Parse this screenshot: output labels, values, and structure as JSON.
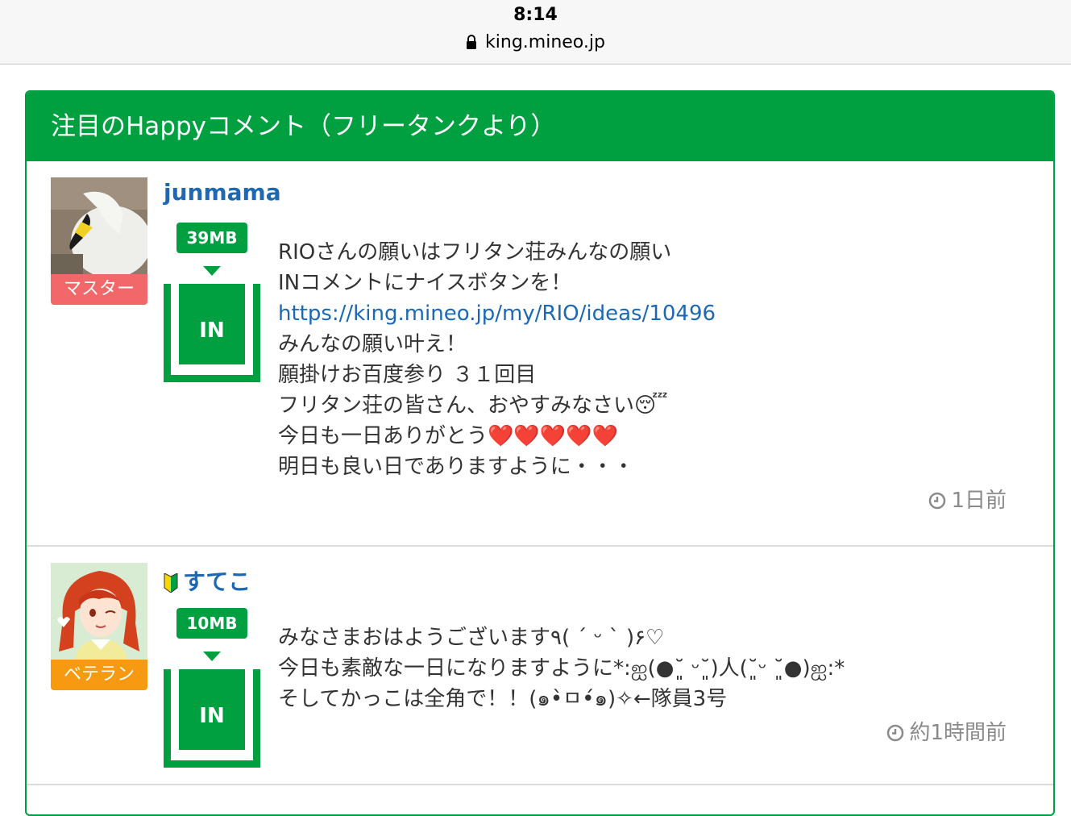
{
  "status_bar": {
    "time": "8:14",
    "url": "king.mineo.jp"
  },
  "panel": {
    "title": "注目のHappyコメント（フリータンクより）"
  },
  "comments": [
    {
      "username": "junmama",
      "rank": "マスター",
      "mb": "39MB",
      "tank_label": "IN",
      "lines": [
        "RIOさんの願いはフリタン荘みんなの願い",
        "INコメントにナイスボタンを！",
        "https://king.mineo.jp/my/RIO/ideas/10496",
        "みんなの願い叶え！",
        "願掛けお百度参り ３１回目",
        "フリタン荘の皆さん、おやすみなさい😴",
        "今日も一日ありがとう",
        "明日も良い日でありますように・・・"
      ],
      "hearts": "❤️❤️❤️❤️❤️",
      "time": "1日前"
    },
    {
      "username": "すてこ",
      "rank": "ベテラン",
      "mb": "10MB",
      "tank_label": "IN",
      "lines": [
        "みなさまおはようございます٩( ´ ᵕ ` )۶♡",
        "今日も素敵な一日になりますように*:ஐ(●˘͈ ᵕ˘͈)人(˘͈ᵕ ˘͈●)ஐ:*",
        "そしてかっこは全角で！！(๑•̀ㅁ•́๑)✧←隊員3号"
      ],
      "time": "約1時間前"
    }
  ],
  "colors": {
    "brand_green": "#00a040",
    "link_blue": "#1d68b4",
    "master_badge": "#f2676a",
    "veteran_badge": "#f79a11"
  }
}
